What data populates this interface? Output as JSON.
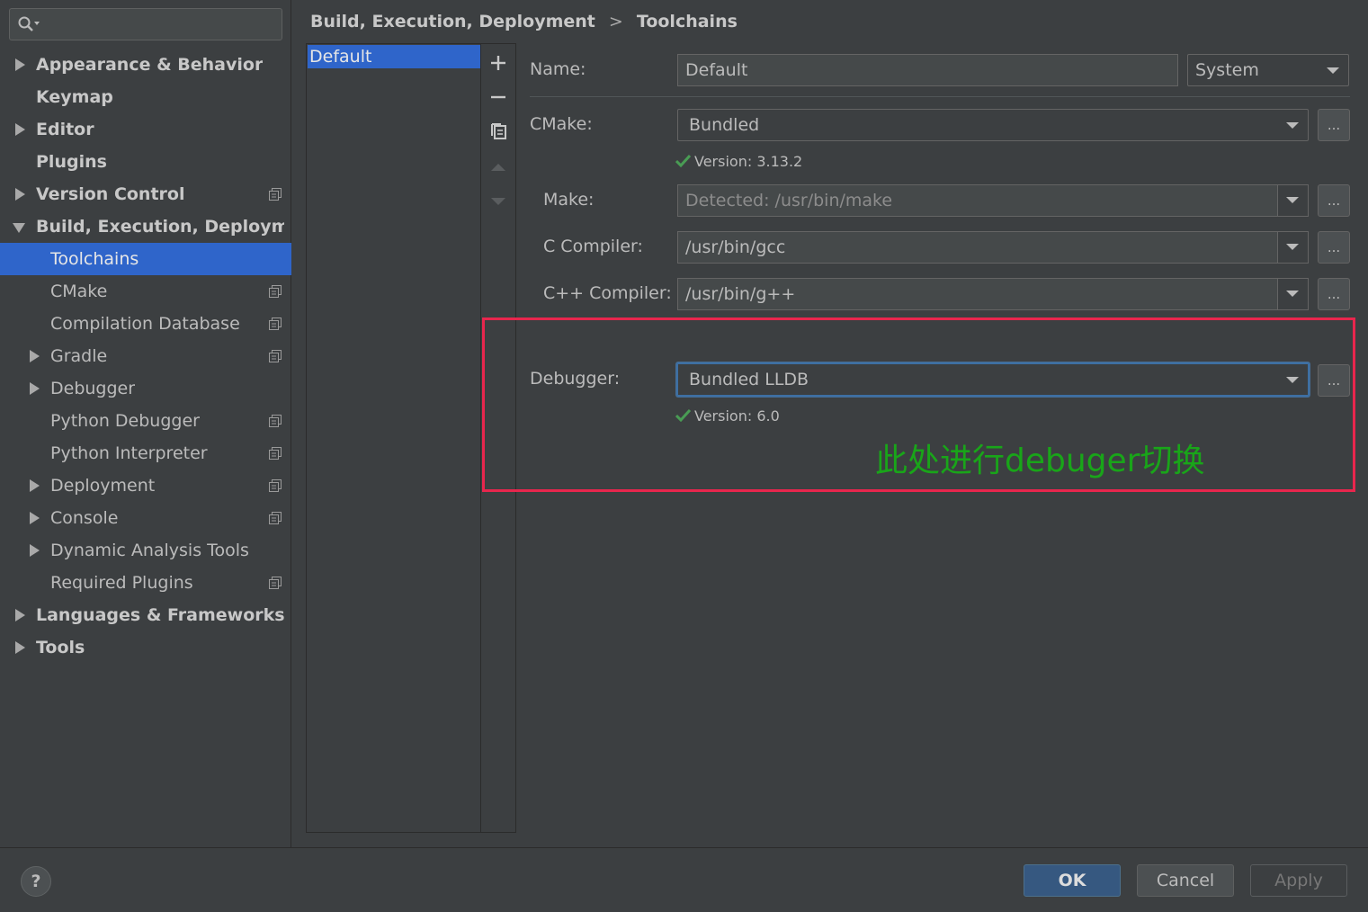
{
  "search": {
    "placeholder": ""
  },
  "sidebar": {
    "items": [
      {
        "label": "Appearance & Behavior"
      },
      {
        "label": "Keymap"
      },
      {
        "label": "Editor"
      },
      {
        "label": "Plugins"
      },
      {
        "label": "Version Control"
      },
      {
        "label": "Build, Execution, Deployment"
      },
      {
        "label": "Toolchains"
      },
      {
        "label": "CMake"
      },
      {
        "label": "Compilation Database"
      },
      {
        "label": "Gradle"
      },
      {
        "label": "Debugger"
      },
      {
        "label": "Python Debugger"
      },
      {
        "label": "Python Interpreter"
      },
      {
        "label": "Deployment"
      },
      {
        "label": "Console"
      },
      {
        "label": "Dynamic Analysis Tools"
      },
      {
        "label": "Required Plugins"
      },
      {
        "label": "Languages & Frameworks"
      },
      {
        "label": "Tools"
      }
    ]
  },
  "breadcrumb": {
    "parent": "Build, Execution, Deployment",
    "separator": ">",
    "current": "Toolchains"
  },
  "toolchains": {
    "items": [
      "Default"
    ]
  },
  "form": {
    "name_label": "Name:",
    "name_value": "Default",
    "env_value": "System",
    "cmake_label": "CMake:",
    "cmake_value": "Bundled",
    "cmake_version": "Version: 3.13.2",
    "make_label": "Make:",
    "make_value": "Detected: /usr/bin/make",
    "c_compiler_label": "C Compiler:",
    "c_compiler_value": "/usr/bin/gcc",
    "cpp_compiler_label": "C++ Compiler:",
    "cpp_compiler_value": "/usr/bin/g++",
    "debugger_label": "Debugger:",
    "debugger_value": "Bundled LLDB",
    "debugger_version": "Version: 6.0",
    "browse_label": "..."
  },
  "annotation": {
    "text": "此处进行debuger切换"
  },
  "buttons": {
    "help": "?",
    "ok": "OK",
    "cancel": "Cancel",
    "apply": "Apply"
  },
  "colors": {
    "selection": "#2f65ca",
    "highlight_border": "#e8264d",
    "annotation_text": "#19a519",
    "check": "#499c54"
  }
}
